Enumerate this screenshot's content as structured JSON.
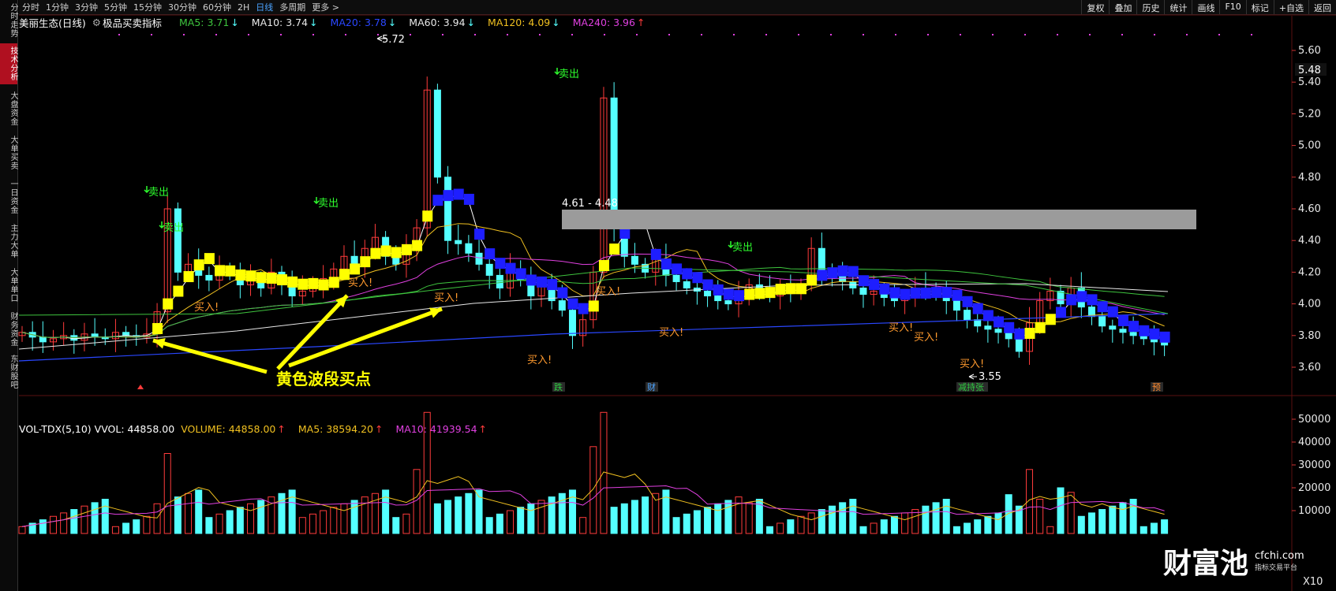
{
  "toolbar": {
    "periods": [
      "分时",
      "1分钟",
      "3分钟",
      "5分钟",
      "15分钟",
      "30分钟",
      "60分钟",
      "2H",
      "日线",
      "多周期",
      "更多 >"
    ],
    "active_period": "日线",
    "right_tools": [
      "复权",
      "叠加",
      "历史",
      "统计",
      "画线",
      "F10",
      "标记",
      "+自选",
      "返回"
    ]
  },
  "sidebar": {
    "tabs": [
      "分时走势",
      "技术分析",
      "大盘资金",
      "大单买卖",
      "一日资金",
      "主力大单",
      "大单单口",
      "财务资金",
      "东财股吧"
    ],
    "active": "技术分析"
  },
  "main": {
    "stock_title": "美丽生态(日线)",
    "indicator_name": "极品买卖指标",
    "ma_items": [
      {
        "text": "MA5: 3.71",
        "arrow": "↓",
        "color": "#3ec43e"
      },
      {
        "text": "MA10: 3.74",
        "arrow": "↓",
        "color": "#e8e8e8"
      },
      {
        "text": "MA20: 3.78",
        "arrow": "↓",
        "color": "#2a47ff"
      },
      {
        "text": "MA60: 3.94",
        "arrow": "↓",
        "color": "#e8e8e8"
      },
      {
        "text": "MA120: 4.09",
        "arrow": "↓",
        "color": "#f0c020"
      },
      {
        "text": "MA240: 3.96",
        "arrow": "↑",
        "color": "#e040e0"
      }
    ],
    "current_price_tag": "5.48",
    "price_axis": [
      "5.60",
      "5.40",
      "5.20",
      "5.00",
      "4.80",
      "4.60",
      "4.40",
      "4.20",
      "4.00",
      "3.80",
      "3.60"
    ],
    "range_label": "4.61 - 4.48",
    "high_label": "5.72",
    "low_label": "3.55",
    "annotation": "黄色波段买点",
    "sell_label": "卖出",
    "buy_label": "买入!",
    "event_badges": [
      "跌",
      "财",
      "减持张",
      "预"
    ]
  },
  "volume": {
    "indicator": "VOL-TDX(5,10) VVOL: 44858.00",
    "items": [
      {
        "text": "VOLUME: 44858.00",
        "arrow": "↑",
        "color": "#f0c020"
      },
      {
        "text": "MA5: 38594.20",
        "arrow": "↑",
        "color": "#f0c020"
      },
      {
        "text": "MA10: 41939.54",
        "arrow": "↑",
        "color": "#e040e0"
      }
    ],
    "axis": [
      "50000",
      "40000",
      "30000",
      "20000",
      "10000"
    ],
    "unit": "X10"
  },
  "watermark": {
    "logo": "财富池",
    "url": "cfchi.com",
    "tagline": "指标交易平台"
  },
  "colors": {
    "up": "#ff3b3b",
    "down": "#54ffff",
    "band_yellow": "#ffff00",
    "band_blue": "#1e1eff",
    "buy": "#ff9a2e",
    "sell": "#2eff2e"
  }
}
